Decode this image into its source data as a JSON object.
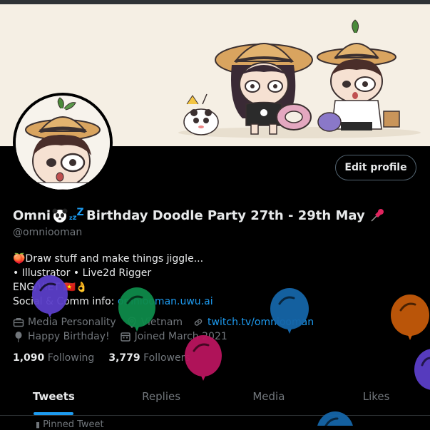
{
  "profile": {
    "name": "Omni🐼 ᶻᶻᶻ Birthday Doodle Party 27th - 29th May 📌",
    "name_main": "Omni",
    "name_rest": "Birthday Doodle Party 27th - 29th May",
    "handle": "@omniooman",
    "edit_label": "Edit profile"
  },
  "bio": {
    "line1": "🍑Draw stuff and make things jiggle...",
    "line2": "• Illustrator • Live2d Rigger",
    "line3": "ENG/VIET 🇻🇳👌",
    "line4_prefix": "Social & Comm info: ",
    "line4_link": "omniooman.uwu.ai"
  },
  "meta": {
    "category": "Media Personality",
    "location": "Vietnam",
    "website": "twitch.tv/omniooman",
    "birthday": "Happy Birthday!",
    "joined": "Joined March 2021"
  },
  "stats": {
    "following_count": "1,090",
    "following_label": "Following",
    "followers_count": "3,779",
    "followers_label": "Followers"
  },
  "tabs": [
    {
      "label": "Tweets",
      "active": true
    },
    {
      "label": "Replies",
      "active": false
    },
    {
      "label": "Media",
      "active": false
    },
    {
      "label": "Likes",
      "active": false
    }
  ],
  "pinned_label": "Pinned Tweet",
  "colors": {
    "accent": "#1d9bf0",
    "background": "#000000",
    "muted": "#71767b",
    "balloon_purple": "#5b3ec8",
    "balloon_green": "#0e8a4a",
    "balloon_magenta": "#b8145e",
    "balloon_blue": "#1565a8",
    "balloon_orange": "#c45a0a"
  }
}
